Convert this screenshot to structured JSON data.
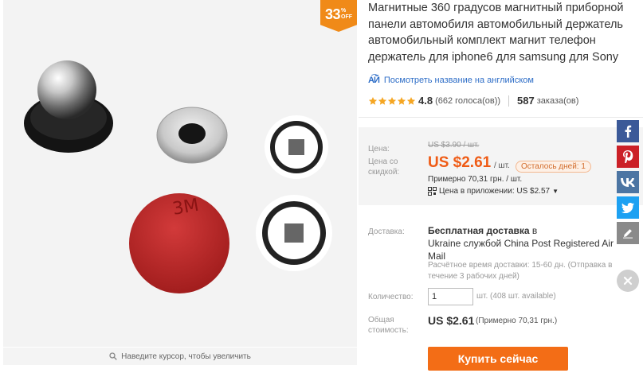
{
  "gallery": {
    "discount_percent": "33",
    "discount_sign": "%",
    "discount_word": "OFF",
    "zoom_hint": "Наведите курсор, чтобы увеличить"
  },
  "product": {
    "title_lines": [
      "Магнитные 360 градусов магнитный приборной",
      "панели автомобиля автомобильный держатель",
      "автомобильный комплект магнит телефон",
      "держатель для iphone6 для samsung для Sony"
    ],
    "translate_link": "Посмотреть название на английском",
    "rating": "4.8",
    "stars": 5,
    "votes": "(662 голоса(ов))",
    "orders_count": "587",
    "orders_label": "заказа(ов)"
  },
  "price": {
    "price_label": "Цена:",
    "old_price": "US $3.90 / шт.",
    "discount_label": "Цена со скидкой:",
    "current_price": "US $2.61",
    "unit": "/ шт.",
    "days_left": "Осталось дней: 1",
    "approx_uah": "Примерно 70,31 грн. / шт.",
    "app_price": "Цена в приложении: US $2.57"
  },
  "shipping": {
    "label": "Доставка:",
    "free_text": "Бесплатная доставка",
    "to_text": "в",
    "line2": "Ukraine службой China Post Registered Air",
    "line3": "Mail",
    "estimate": "Расчётное время доставки: 15-60 дн. (Отправка в течение 3 рабочих дней)"
  },
  "quantity": {
    "label": "Количество:",
    "value": "1",
    "available": "шт. (408 шт. available)"
  },
  "total": {
    "label": "Общая стоимость:",
    "price": "US $2.61",
    "approx": "(Примерно 70,31 грн.)"
  },
  "buy_button": "Купить сейчас",
  "colors": {
    "accent_orange": "#f36d16",
    "price_orange": "#ef5b15",
    "badge_orange": "#f08a18",
    "link_blue": "#2d6dc7",
    "star_orange": "#f5a623"
  },
  "social_icons": [
    "facebook-icon",
    "pinterest-icon",
    "vk-icon",
    "twitter-icon",
    "edit-icon",
    "close-icon"
  ]
}
